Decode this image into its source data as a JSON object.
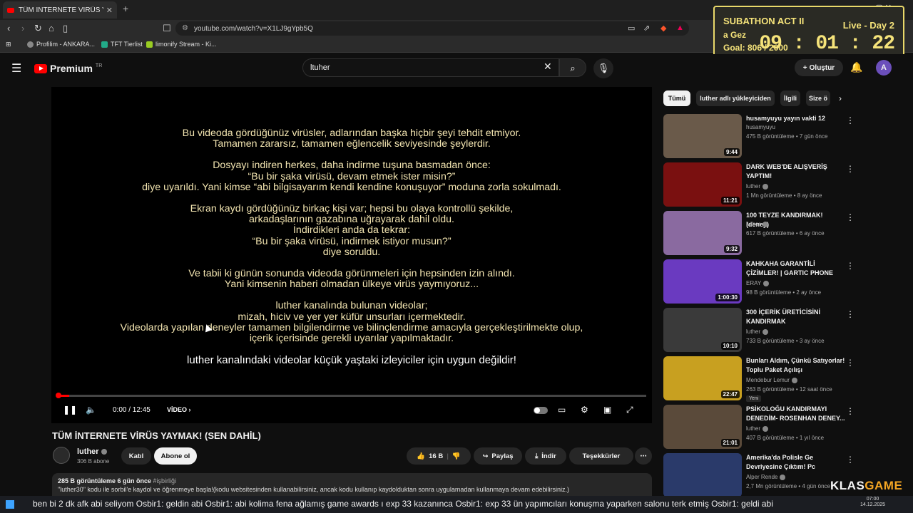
{
  "browser": {
    "tab_title": "TÜM İNTERNETE VİRÜS YAYMAK",
    "url": "youtube.com/watch?v=X1LJ9gYpb5Q",
    "bookmarks": [
      "Profilim - ANKARA...",
      "TFT Tierlist",
      "limonify Stream - Ki..."
    ]
  },
  "overlay": {
    "title": "SUBATHON ACT II",
    "live": "Live - Day 2",
    "subtitle": "a Gez",
    "goal": "Goal: 806 / 2000",
    "timer": "09 : 01 : 22",
    "brand_a": "KLAS",
    "brand_b": "GAME"
  },
  "header": {
    "logo_text": "Premium",
    "logo_sup": "TR",
    "search_value": "ltuher",
    "create_label": "Oluştur",
    "avatar_letter": "A"
  },
  "player": {
    "lines": [
      [
        "Bu videoda gördüğünüz virüsler, adlarından başka hiçbir şeyi tehdit etmiyor.",
        "Tamamen zararsız, tamamen eğlencelik seviyesinde şeylerdir."
      ],
      [
        "Dosyayı indiren herkes, daha indirme tuşuna basmadan önce:",
        "“Bu bir şaka virüsü, devam etmek ister misin?”",
        "diye uyarıldı. Yani kimse “abi bilgisayarım kendi kendine konuşuyor” moduna zorla sokulmadı."
      ],
      [
        "Ekran kaydı gördüğünüz birkaç kişi var; hepsi bu olaya kontrollü şekilde,",
        "arkadaşlarının gazabına uğrayarak dahil oldu.",
        "İndirdikleri anda da tekrar:",
        "“Bu bir şaka virüsü, indirmek istiyor musun?”",
        "diye soruldu."
      ],
      [
        "Ve tabii ki günün sonunda videoda görünmeleri için hepsinden izin alındı.",
        "Yani kimsenin haberi olmadan ülkeye virüs yaymıyoruz..."
      ],
      [
        "luther kanalında bulunan videolar;",
        "mizah, hiciv ve yer yer küfür unsurları içermektedir.",
        "Videolarda yapılan deneyler tamamen bilgilendirme ve bilinçlendirme amacıyla gerçekleştirilmekte olup,",
        "içerik içerisinde gerekli uyarılar yapılmaktadır."
      ]
    ],
    "final_line": "luther kanalındaki videolar küçük yaştaki izleyiciler için uygun değildir!",
    "timecode": "0:00 / 12:45",
    "chapter": "VİDEO",
    "progress": 0.02
  },
  "video": {
    "title": "TÜM İNTERNETE VİRÜS YAYMAK! (SEN DAHİL)",
    "channel": "luther",
    "subs": "306 B abone",
    "join": "Katıl",
    "subscribe": "Abone ol",
    "likes": "16 B",
    "share": "Paylaş",
    "download": "İndir",
    "thanks": "Teşekkürler",
    "views_date": "285 B görüntüleme  6 gün önce",
    "hashtag": "#işbirliği",
    "desc_line": "\"luther30\" kodu ile sorbil'e kaydol ve öğrenmeye başla!(kodu websitesinden kullanabilirsiniz, ancak kodu kullanıp kaydolduktan sonra uygulamadan kullanmaya devam edebilirsiniz.)"
  },
  "chips": [
    "Tümü",
    "luther adlı yükleyiciden",
    "İlgili",
    "Size ö"
  ],
  "recs": [
    {
      "title": "husamyuyu yayın vakti 12",
      "channel": "husamyuyu",
      "meta": "475 B görüntüleme • 7 gün önce",
      "dur": "9:44",
      "color": "#6a5a4a",
      "verified": false
    },
    {
      "title": "DARK WEB'DE ALIŞVERİŞ YAPTIM!",
      "channel": "luther",
      "meta": "1 Mn görüntüleme • 8 ay önce",
      "dur": "11:21",
      "color": "#7a1010",
      "verified": true
    },
    {
      "title": "100 TEYZE KANDIRMAK! (deney)",
      "channel": "luther",
      "meta": "617 B görüntüleme • 6 ay önce",
      "dur": "9:32",
      "color": "#8a6aa0",
      "verified": true
    },
    {
      "title": "KAHKAHA GARANTİLİ ÇİZİMLER! | GARTIC PHONE",
      "channel": "ERAY",
      "meta": "98 B görüntüleme • 2 ay önce",
      "dur": "1:00:30",
      "color": "#6a3ac0",
      "verified": true
    },
    {
      "title": "300 İÇERİK ÜRETİCİSİNİ KANDIRMAK",
      "channel": "luther",
      "meta": "733 B görüntüleme • 3 ay önce",
      "dur": "10:10",
      "color": "#3a3a3a",
      "verified": true
    },
    {
      "title": "Bunları Aldım, Çünkü Satıyorlar! Toplu Paket Açılışı",
      "channel": "Mendebur Lemur",
      "meta": "263 B görüntüleme • 12 saat önce",
      "dur": "22:47",
      "color": "#c8a020",
      "verified": true,
      "badge": "Yeni"
    },
    {
      "title": "PSİKOLOĞU KANDIRMAYI DENEDİM- ROSENHAN DENEY...",
      "channel": "luther",
      "meta": "407 B görüntüleme • 1 yıl önce",
      "dur": "21:01",
      "color": "#5a4a3a",
      "verified": true
    },
    {
      "title": "Amerika'da Polisle Ge Devriyesine Çıktım! Pc",
      "channel": "Alper Rende",
      "meta": "2,7 Mn görüntüleme • 4 gün önce",
      "dur": "",
      "color": "#2a3a6a",
      "verified": true
    }
  ],
  "ticker": {
    "text": "ben bi 2 dk afk abi seliyom   Osbir1: geldin abi   Osbir1: abi kolima fena ağlamış game awards ı exp 33 kazanınca   Osbir1: exp 33 ün yapımcıları konuşma yaparken salonu terk etmiş   Osbir1: geldi abi",
    "clock": "07:00",
    "date": "14.12.2025"
  }
}
